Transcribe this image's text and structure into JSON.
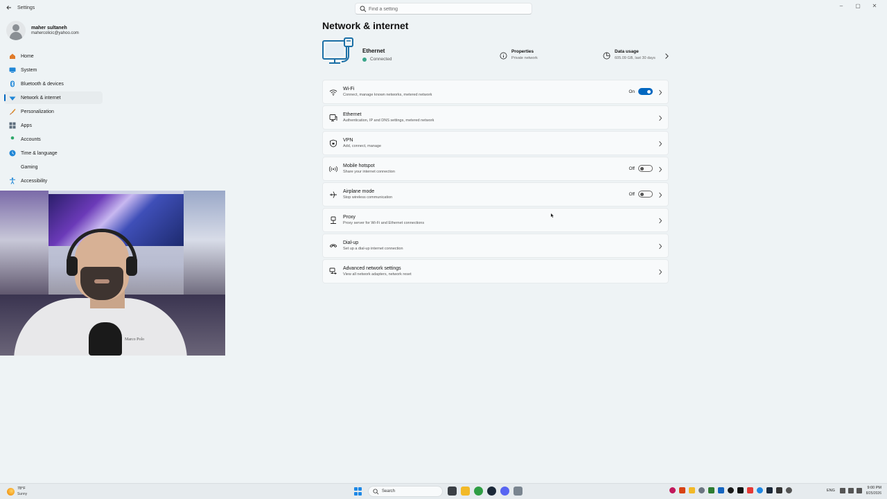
{
  "window": {
    "title": "Settings",
    "controls": [
      "–",
      "▢",
      "✕"
    ]
  },
  "search": {
    "placeholder": "Find a setting"
  },
  "user": {
    "name": "maher sultaneh",
    "email": "mahercolicic@yahoo.com"
  },
  "sidebar": {
    "items": [
      {
        "label": "Home",
        "icon": "home-icon",
        "color": "#e07b2a",
        "active": false
      },
      {
        "label": "System",
        "icon": "system-icon",
        "color": "#1f86d6",
        "active": false
      },
      {
        "label": "Bluetooth & devices",
        "icon": "bluetooth-icon",
        "color": "#1f86d6",
        "active": false
      },
      {
        "label": "Network & internet",
        "icon": "network-icon",
        "color": "#1f86d6",
        "active": true
      },
      {
        "label": "Personalization",
        "icon": "brush-icon",
        "color": "#d98a2b",
        "active": false
      },
      {
        "label": "Apps",
        "icon": "apps-icon",
        "color": "#5b6b7a",
        "active": false
      },
      {
        "label": "Accounts",
        "icon": "accounts-icon",
        "color": "#2fa86a",
        "active": false
      },
      {
        "label": "Time & language",
        "icon": "time-language-icon",
        "color": "#1f86d6",
        "active": false
      },
      {
        "label": "Gaming",
        "icon": "gaming-icon",
        "color": "#6b7580",
        "active": false
      },
      {
        "label": "Accessibility",
        "icon": "accessibility-icon",
        "color": "#1f86d6",
        "active": false
      }
    ]
  },
  "main": {
    "title": "Network & internet",
    "hero": {
      "title": "Ethernet",
      "status": "Connected",
      "properties": {
        "title": "Properties",
        "subtitle": "Private network"
      },
      "data_usage": {
        "title": "Data usage",
        "subtitle": "605.09 GB, last 30 days"
      }
    },
    "cards": [
      {
        "title": "Wi-Fi",
        "subtitle": "Connect, manage known networks, metered network",
        "icon": "wifi-icon",
        "state": "On",
        "toggle": true
      },
      {
        "title": "Ethernet",
        "subtitle": "Authentication, IP and DNS settings, metered network",
        "icon": "ethernet-icon",
        "state": "",
        "toggle": null
      },
      {
        "title": "VPN",
        "subtitle": "Add, connect, manage",
        "icon": "vpn-shield-icon",
        "state": "",
        "toggle": null
      },
      {
        "title": "Mobile hotspot",
        "subtitle": "Share your internet connection",
        "icon": "hotspot-icon",
        "state": "Off",
        "toggle": false
      },
      {
        "title": "Airplane mode",
        "subtitle": "Stop wireless communication",
        "icon": "airplane-icon",
        "state": "Off",
        "toggle": false
      },
      {
        "title": "Proxy",
        "subtitle": "Proxy server for Wi-Fi and Ethernet connections",
        "icon": "proxy-icon",
        "state": "",
        "toggle": null
      },
      {
        "title": "Dial-up",
        "subtitle": "Set up a dial-up internet connection",
        "icon": "dialup-icon",
        "state": "",
        "toggle": null
      },
      {
        "title": "Advanced network settings",
        "subtitle": "View all network adapters, network reset",
        "icon": "advanced-network-icon",
        "state": "",
        "toggle": null
      }
    ]
  },
  "webcam": {
    "logo_text": "Marco Polo"
  },
  "taskbar": {
    "weather": {
      "temp": "78°F",
      "condition": "Sunny"
    },
    "search_label": "Search",
    "apps": [
      {
        "name": "task-view",
        "color": "#3a3f45"
      },
      {
        "name": "file-explorer",
        "color": "#f2b928"
      },
      {
        "name": "chrome",
        "color": "#2f9e44"
      },
      {
        "name": "steam",
        "color": "#1b2838"
      },
      {
        "name": "discord",
        "color": "#5865f2"
      },
      {
        "name": "settings",
        "color": "#7a8590"
      }
    ],
    "tray_colors": [
      "#c2185b",
      "#d84315",
      "#f2b928",
      "#6b7580",
      "#2e7d32",
      "#1565c0",
      "#1b1b1b",
      "#111111",
      "#e53935",
      "#1e88e5",
      "#1b2838",
      "#333333",
      "#555555"
    ],
    "language": "ENG",
    "time": "9:00 PM",
    "date": "8/25/2026"
  },
  "colors": {
    "accent": "#0067c0",
    "background": "#eef3f5"
  }
}
